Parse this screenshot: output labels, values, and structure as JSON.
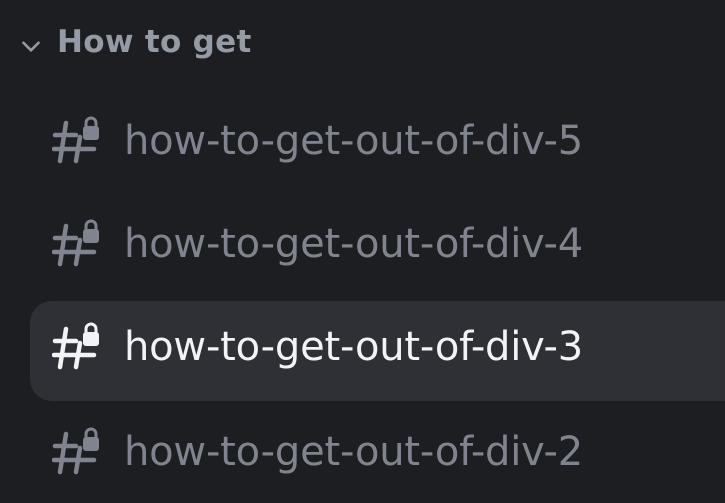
{
  "category": {
    "label": "How to get",
    "expanded": true,
    "icon": "chevron-down-icon"
  },
  "channels": [
    {
      "name": "how-to-get-out-of-div-5",
      "icon": "locked-text-channel-icon",
      "active": false
    },
    {
      "name": "how-to-get-out-of-div-4",
      "icon": "locked-text-channel-icon",
      "active": false
    },
    {
      "name": "how-to-get-out-of-div-3",
      "icon": "locked-text-channel-icon",
      "active": true
    },
    {
      "name": "how-to-get-out-of-div-2",
      "icon": "locked-text-channel-icon",
      "active": false
    }
  ],
  "colors": {
    "background": "#1d1e22",
    "active_row": "#2e3036",
    "muted_text": "#80848e",
    "category_text": "#949ba4",
    "active_text": "#f2f3f5"
  }
}
